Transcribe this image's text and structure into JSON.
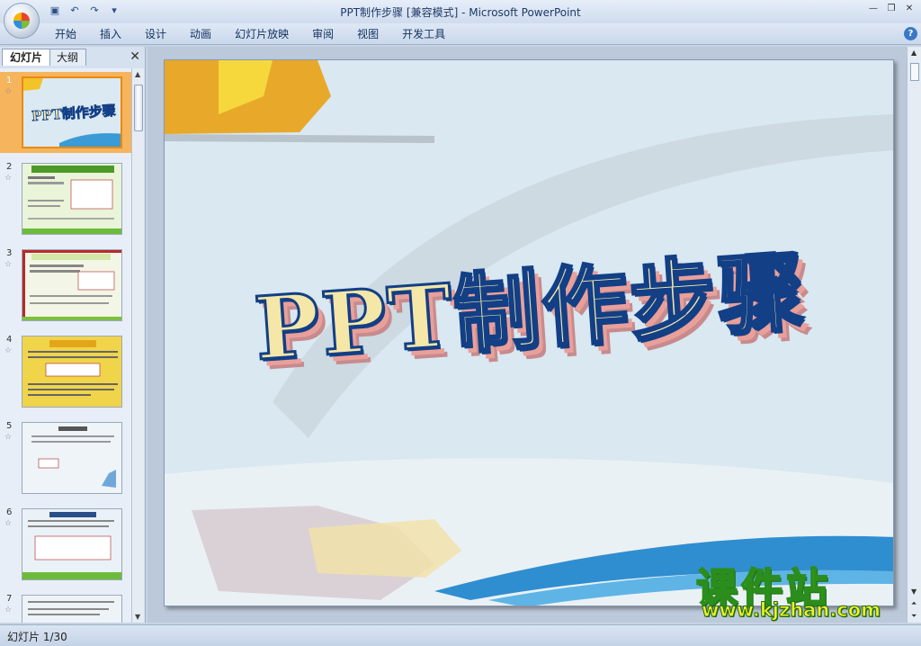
{
  "window": {
    "document": "PPT制作步骤",
    "mode": "[兼容模式]",
    "separator": " - ",
    "app": "Microsoft PowerPoint"
  },
  "ribbon": {
    "tabs": [
      "开始",
      "插入",
      "设计",
      "动画",
      "幻灯片放映",
      "审阅",
      "视图",
      "开发工具"
    ],
    "help": "?"
  },
  "panel": {
    "tab_slides": "幻灯片",
    "tab_outline": "大纲",
    "close": "✕",
    "slides": [
      {
        "num": "1",
        "star": "☆",
        "label": "PPT制作步骤"
      },
      {
        "num": "2",
        "star": "☆"
      },
      {
        "num": "3",
        "star": "☆"
      },
      {
        "num": "4",
        "star": "☆"
      },
      {
        "num": "5",
        "star": "☆"
      },
      {
        "num": "6",
        "star": "☆"
      },
      {
        "num": "7",
        "star": "☆"
      }
    ]
  },
  "slide": {
    "title": "PPT制作步骤"
  },
  "watermark": {
    "cn": "课件站",
    "url": "www.kjzhan.com"
  },
  "statusbar": {
    "text": "幻灯片 1/30"
  },
  "colors": {
    "selected_thumb": "#f6b45c",
    "title_stroke": "#123f86",
    "watermark_yellow": "#f4ee10",
    "watermark_green": "#2a8d1c"
  }
}
